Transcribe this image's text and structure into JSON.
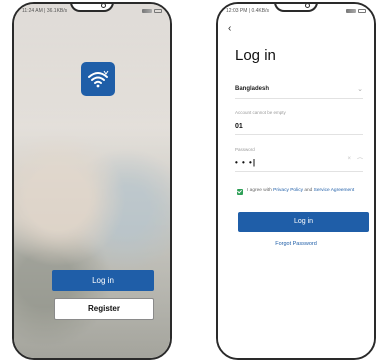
{
  "left_phone": {
    "status": {
      "time": "11:24 AM | 36.1KB/s"
    },
    "login_button": "Log in",
    "register_button": "Register"
  },
  "right_phone": {
    "status": {
      "time": "12:03 PM | 0.4KB/s"
    },
    "title": "Log in",
    "country": {
      "value": "Bangladesh"
    },
    "account": {
      "caption": "Account cannot be empty",
      "value": "01"
    },
    "password": {
      "caption": "Password",
      "value": "• • •|"
    },
    "agreement": {
      "prefix": "I agree with ",
      "privacy_link": "Privacy Policy",
      "middle": " and ",
      "service_link": "Service Agreement"
    },
    "login_button": "Log in",
    "forgot_link": "Forgot Password"
  },
  "colors": {
    "accent": "#1f5ea8",
    "check": "#2e9f57"
  },
  "icons": [
    "wifi-icon",
    "back-arrow-icon",
    "chevron-down-icon",
    "clear-icon",
    "eye-icon",
    "signal-icon",
    "battery-icon"
  ]
}
